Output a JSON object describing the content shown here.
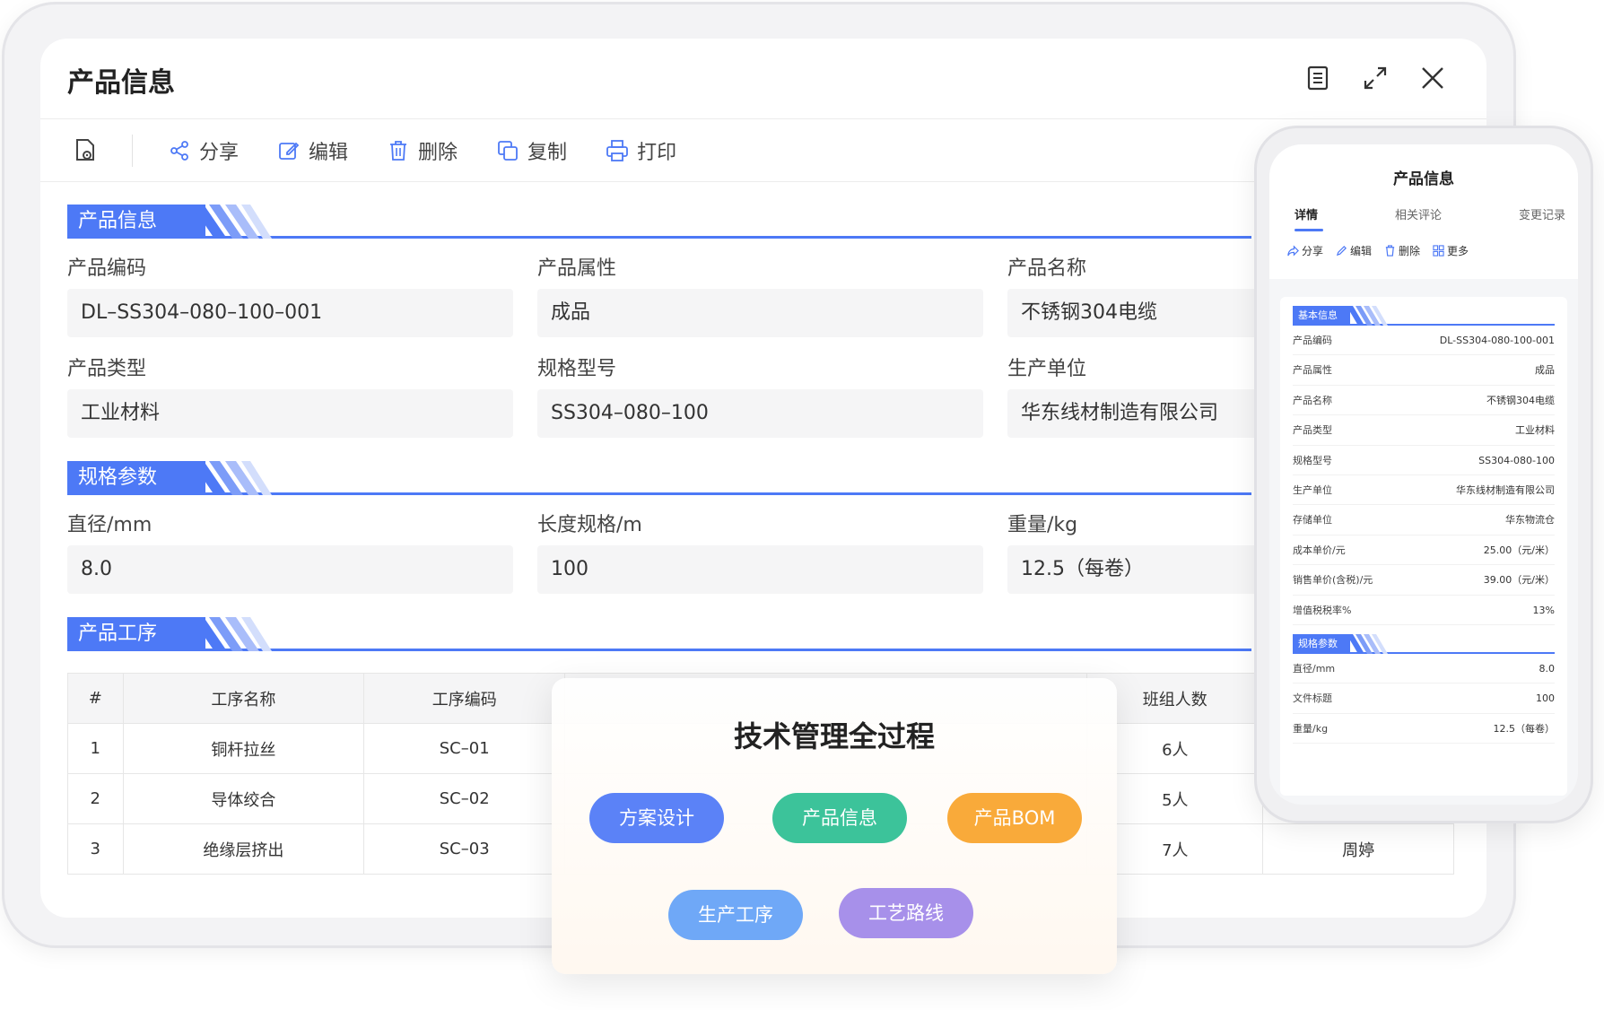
{
  "window": {
    "title": "产品信息",
    "toolbar": [
      "分享",
      "编辑",
      "删除",
      "复制",
      "打印"
    ]
  },
  "sections": {
    "basic": {
      "label": "产品信息",
      "fields": [
        {
          "label": "产品编码",
          "value": "DL–SS304–080–100–001"
        },
        {
          "label": "产品属性",
          "value": "成品"
        },
        {
          "label": "产品名称",
          "value": "不锈钢304电缆"
        },
        {
          "label": "产品类型",
          "value": "工业材料"
        },
        {
          "label": "规格型号",
          "value": "SS304–080–100"
        },
        {
          "label": "生产单位",
          "value": "华东线材制造有限公司"
        }
      ]
    },
    "spec": {
      "label": "规格参数",
      "fields": [
        {
          "label": "直径/mm",
          "value": "8.0"
        },
        {
          "label": "长度规格/m",
          "value": "100"
        },
        {
          "label": "重量/kg",
          "value": "12.5（每卷）"
        }
      ]
    },
    "process": {
      "label": "产品工序",
      "columns": [
        "#",
        "工序名称",
        "工序编码",
        "班组人数"
      ],
      "rows": [
        {
          "no": "1",
          "name": "铜杆拉丝",
          "code": "SC–01",
          "staff": "6人",
          "person": ""
        },
        {
          "no": "2",
          "name": "导体绞合",
          "code": "SC–02",
          "staff": "5人",
          "person": ""
        },
        {
          "no": "3",
          "name": "绝缘层挤出",
          "code": "SC–03",
          "staff": "7人",
          "person": "周婷"
        }
      ]
    }
  },
  "phone": {
    "title": "产品信息",
    "tabs": [
      "详情",
      "相关评论",
      "变更记录"
    ],
    "actions": [
      "分享",
      "编辑",
      "删除",
      "更多"
    ],
    "basic_label": "基本信息",
    "basic_rows": [
      {
        "k": "产品编码",
        "v": "DL-SS304-080-100-001"
      },
      {
        "k": "产品属性",
        "v": "成品"
      },
      {
        "k": "产品名称",
        "v": "不锈钢304电缆"
      },
      {
        "k": "产品类型",
        "v": "工业材料"
      },
      {
        "k": "规格型号",
        "v": "SS304-080-100"
      },
      {
        "k": "生产单位",
        "v": "华东线材制造有限公司"
      },
      {
        "k": "存储单位",
        "v": "华东物流仓"
      },
      {
        "k": "成本单价/元",
        "v": "25.00（元/米）"
      },
      {
        "k": "销售单价(含税)/元",
        "v": "39.00（元/米）"
      },
      {
        "k": "增值税税率%",
        "v": "13%"
      }
    ],
    "spec_label": "规格参数",
    "spec_rows": [
      {
        "k": "直径/mm",
        "v": "8.0"
      },
      {
        "k": "文件标题",
        "v": "100"
      },
      {
        "k": "重量/kg",
        "v": "12.5（每卷）"
      }
    ]
  },
  "overlay": {
    "title": "技术管理全过程",
    "pills": [
      {
        "label": "方案设计",
        "color": "#5b82f7"
      },
      {
        "label": "产品信息",
        "color": "#3cc39a"
      },
      {
        "label": "产品BOM",
        "color": "#f9aa3a"
      },
      {
        "label": "生产工序",
        "color": "#6fa8f7"
      },
      {
        "label": "工艺路线",
        "color": "#a790ea"
      }
    ]
  },
  "colors": {
    "accent": "#4d79f6"
  }
}
